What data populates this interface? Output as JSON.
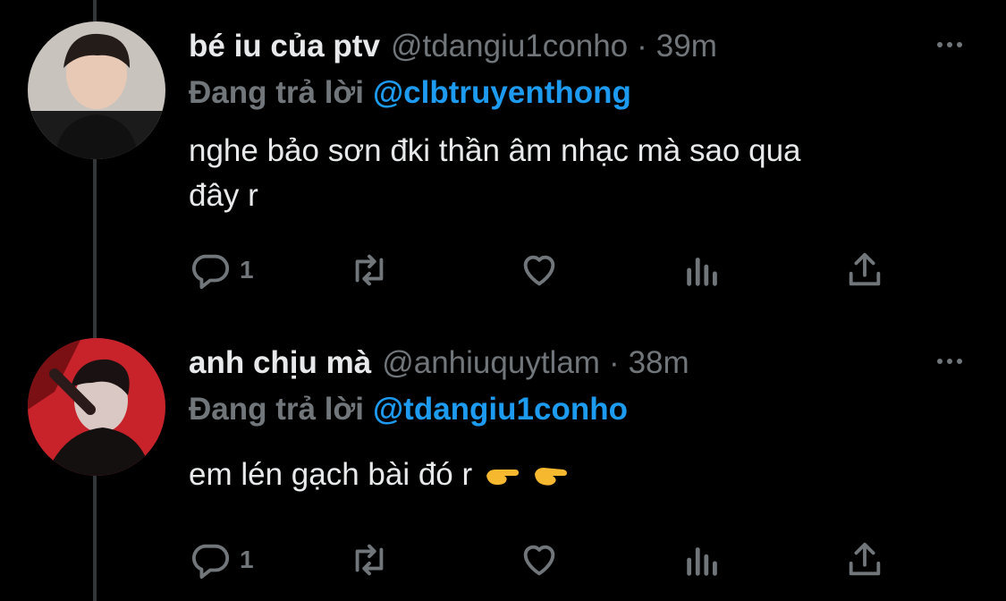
{
  "colors": {
    "background": "#000000",
    "text": "#e7e9ea",
    "muted": "#71767b",
    "accent": "#1d9bf0",
    "thread_line": "#333639"
  },
  "tweets": [
    {
      "avatar_icon": "avatar-photo",
      "display_name": "bé iu của ptv",
      "handle": "@tdangiu1conho",
      "separator": "·",
      "time": "39m",
      "reply_prefix": "Đang trả lời",
      "reply_to": "@clbtruyenthong",
      "text_line1": "nghe bảo sơn đki thần âm nhạc mà sao qua",
      "text_line2": "đây r",
      "reply_count": "1"
    },
    {
      "avatar_icon": "avatar-photo",
      "display_name": "anh chịu mà",
      "handle": "@anhiuquytlam",
      "separator": "·",
      "time": "38m",
      "reply_prefix": "Đang trả lời",
      "reply_to": "@tdangiu1conho",
      "text": "em lén gạch bài đó r",
      "emojis": [
        "backhand-index-pointing-right",
        "backhand-index-pointing-right"
      ],
      "reply_count": "1"
    }
  ]
}
